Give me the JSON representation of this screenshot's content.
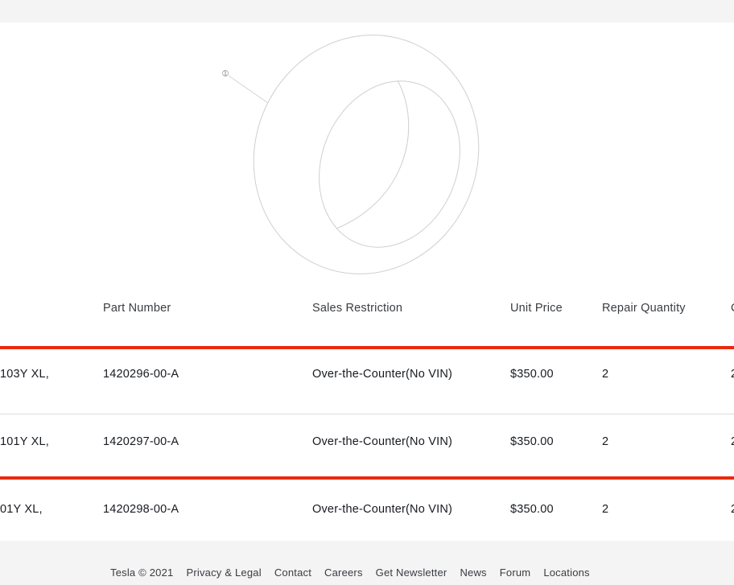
{
  "diagram": {
    "callout": "1"
  },
  "table": {
    "headers": {
      "part_number": "Part Number",
      "sales_restriction": "Sales Restriction",
      "unit_price": "Unit Price",
      "repair_quantity": "Repair Quantity",
      "next_col_partial": "C"
    },
    "rows": [
      {
        "description_partial": "103Y XL,",
        "part_number": "1420296-00-A",
        "sales_restriction": "Over-the-Counter(No VIN)",
        "unit_price": "$350.00",
        "repair_quantity": "2",
        "next_col_partial": "2"
      },
      {
        "description_partial": "101Y XL,",
        "part_number": "1420297-00-A",
        "sales_restriction": "Over-the-Counter(No VIN)",
        "unit_price": "$350.00",
        "repair_quantity": "2",
        "next_col_partial": "2"
      },
      {
        "description_partial": "01Y XL,",
        "part_number": "1420298-00-A",
        "sales_restriction": "Over-the-Counter(No VIN)",
        "unit_price": "$350.00",
        "repair_quantity": "2",
        "next_col_partial": "2"
      }
    ]
  },
  "footer": {
    "copyright": "Tesla © 2021",
    "links": [
      "Privacy & Legal",
      "Contact",
      "Careers",
      "Get Newsletter",
      "News",
      "Forum",
      "Locations"
    ]
  },
  "colors": {
    "highlight": "#e82a0c",
    "footer_bg": "#f4f4f4",
    "text": "#171a20"
  }
}
